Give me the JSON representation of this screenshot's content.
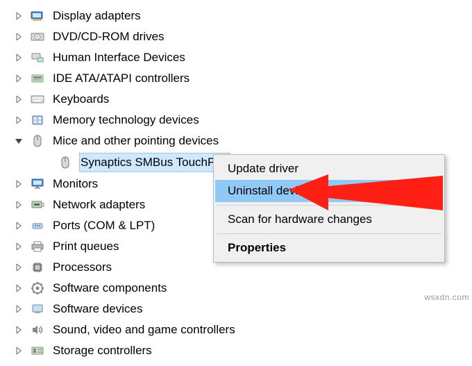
{
  "tree": {
    "display_adapters": "Display adapters",
    "dvd": "DVD/CD-ROM drives",
    "hid": "Human Interface Devices",
    "ide": "IDE ATA/ATAPI controllers",
    "keyboards": "Keyboards",
    "memory_tech": "Memory technology devices",
    "mice": "Mice and other pointing devices",
    "mice_child": "Synaptics SMBus TouchPad",
    "monitors": "Monitors",
    "network": "Network adapters",
    "ports": "Ports (COM & LPT)",
    "print_queues": "Print queues",
    "processors": "Processors",
    "software_components": "Software components",
    "software_devices": "Software devices",
    "sound": "Sound, video and game controllers",
    "storage": "Storage controllers"
  },
  "menu": {
    "update": "Update driver",
    "uninstall": "Uninstall device",
    "scan": "Scan for hardware changes",
    "properties": "Properties"
  },
  "watermark": "wsxdn.com"
}
